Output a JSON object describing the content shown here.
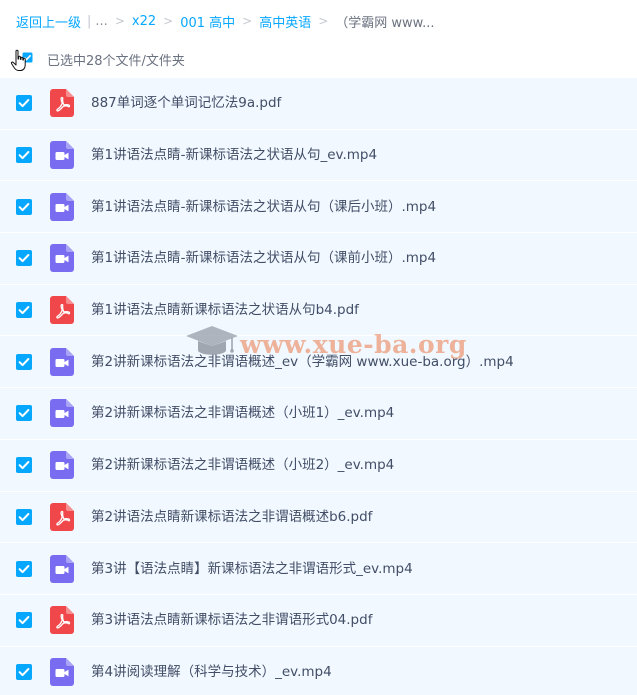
{
  "breadcrumb": {
    "back": "返回上一级",
    "ellipsis": "...",
    "items": [
      "x22",
      "001 高中",
      "高中英语"
    ],
    "current": "（学霸网 www..."
  },
  "selection": {
    "text": "已选中28个文件/文件夹"
  },
  "files": [
    {
      "name": "887单词逐个单词记忆法9a.pdf",
      "type": "pdf",
      "checked": true
    },
    {
      "name": "第1讲语法点睛-新课标语法之状语从句_ev.mp4",
      "type": "video",
      "checked": true
    },
    {
      "name": "第1讲语法点睛-新课标语法之状语从句（课后小班）.mp4",
      "type": "video",
      "checked": true
    },
    {
      "name": "第1讲语法点睛-新课标语法之状语从句（课前小班）.mp4",
      "type": "video",
      "checked": true
    },
    {
      "name": "第1讲语法点睛新课标语法之状语从句b4.pdf",
      "type": "pdf",
      "checked": true
    },
    {
      "name": "第2讲新课标语法之非谓语概述_ev（学霸网 www.xue-ba.org）.mp4",
      "type": "video",
      "checked": true
    },
    {
      "name": "第2讲新课标语法之非谓语概述（小班1）_ev.mp4",
      "type": "video",
      "checked": true
    },
    {
      "name": "第2讲新课标语法之非谓语概述（小班2）_ev.mp4",
      "type": "video",
      "checked": true
    },
    {
      "name": "第2讲语法点睛新课标语法之非谓语概述b6.pdf",
      "type": "pdf",
      "checked": true
    },
    {
      "name": "第3讲【语法点睛】新课标语法之非谓语形式_ev.mp4",
      "type": "video",
      "checked": true
    },
    {
      "name": "第3讲语法点睛新课标语法之非谓语形式04.pdf",
      "type": "pdf",
      "checked": true
    },
    {
      "name": "第4讲阅读理解（科学与技术）_ev.mp4",
      "type": "video",
      "checked": true
    }
  ],
  "watermark": {
    "text": "www.xue-ba.org"
  },
  "colors": {
    "accent": "#06a7ff",
    "pdf": "#f0484a",
    "video": "#7a6cf0",
    "row_bg": "#f1f8ff"
  },
  "icons": {
    "pdf": "pdf-file-icon",
    "video": "video-file-icon",
    "cursor": "hand-cursor-icon"
  }
}
